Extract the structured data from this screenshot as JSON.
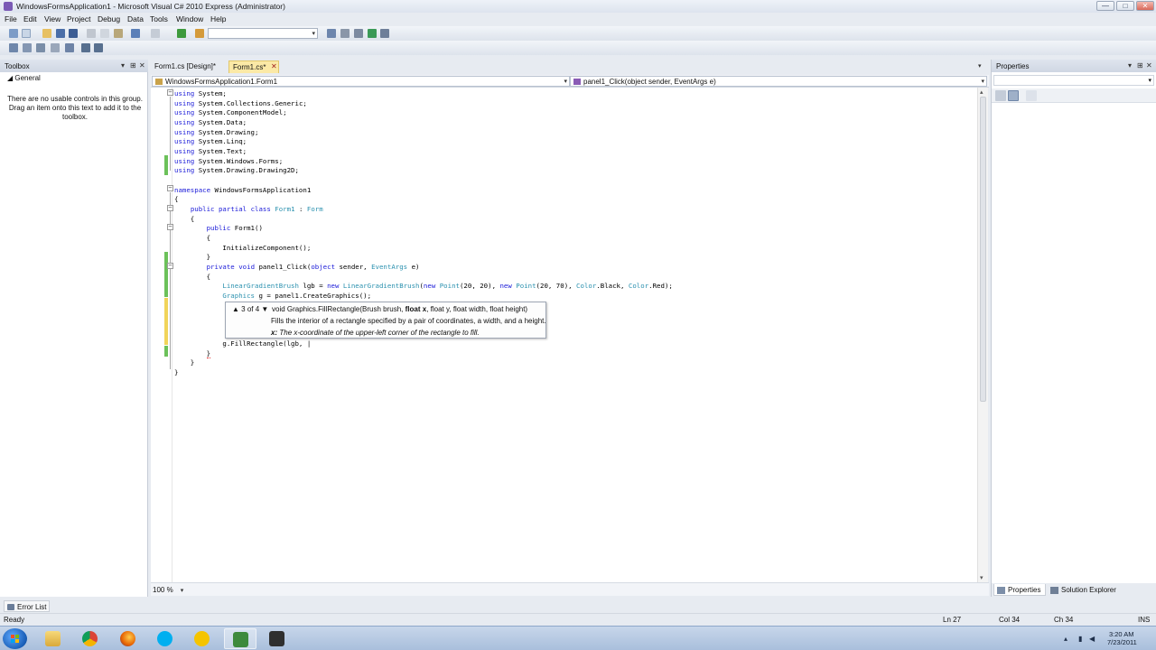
{
  "window": {
    "title": "WindowsFormsApplication1 - Microsoft Visual C# 2010 Express (Administrator)",
    "minimize": "—",
    "maximize": "□",
    "close": "✕"
  },
  "menu": [
    "File",
    "Edit",
    "View",
    "Project",
    "Debug",
    "Data",
    "Tools",
    "Window",
    "Help"
  ],
  "toolbox": {
    "title": "Toolbox",
    "group": "◢ General",
    "message": "There are no usable controls in this group. Drag an item onto this text to add it to the toolbox.",
    "pin": "▾ ▭ ✕"
  },
  "tabs": {
    "design": "Form1.cs [Design]*",
    "code": "Form1.cs*",
    "close": "✕"
  },
  "navbar": {
    "left": "WindowsFormsApplication1.Form1",
    "right": "panel1_Click(object sender, EventArgs e)"
  },
  "code": {
    "lines": [
      "using System;",
      "using System.Collections.Generic;",
      "using System.ComponentModel;",
      "using System.Data;",
      "using System.Drawing;",
      "using System.Linq;",
      "using System.Text;",
      "using System.Windows.Forms;",
      "using System.Drawing.Drawing2D;",
      "",
      "namespace WindowsFormsApplication1",
      "{",
      "    public partial class Form1 : Form",
      "    {",
      "        public Form1()",
      "        {",
      "            InitializeComponent();",
      "        }",
      "        private void panel1_Click(object sender, EventArgs e)",
      "        {",
      "            LinearGradientBrush lgb = new LinearGradientBrush(new Point(20, 20), new Point(20, 70), Color.Black, Color.Red);",
      "            Graphics g = panel1.CreateGraphics();",
      "",
      "",
      "",
      "            g.FillRectangle(lgb, |",
      "        }",
      "    }",
      "}"
    ]
  },
  "tooltip": {
    "overload": "3 of 4",
    "sig_pre": "void Graphics.FillRectangle(Brush brush, ",
    "sig_bold": "float x",
    "sig_post": ", float y, float width, float height)",
    "desc": "Fills the interior of a rectangle specified by a pair of coordinates, a width, and a height.",
    "param_name": "x:",
    "param_desc": "The x-coordinate of the upper-left corner of the rectangle to fill."
  },
  "editor": {
    "zoom": "100 %"
  },
  "properties": {
    "title": "Properties",
    "tab_properties": "Properties",
    "tab_solution": "Solution Explorer"
  },
  "errorlist": {
    "label": "Error List"
  },
  "status": {
    "ready": "Ready",
    "ln": "Ln 27",
    "col": "Col 34",
    "ch": "Ch 34",
    "ins": "INS"
  },
  "taskbar": {
    "time": "3:20 AM",
    "date": "7/23/2011"
  }
}
